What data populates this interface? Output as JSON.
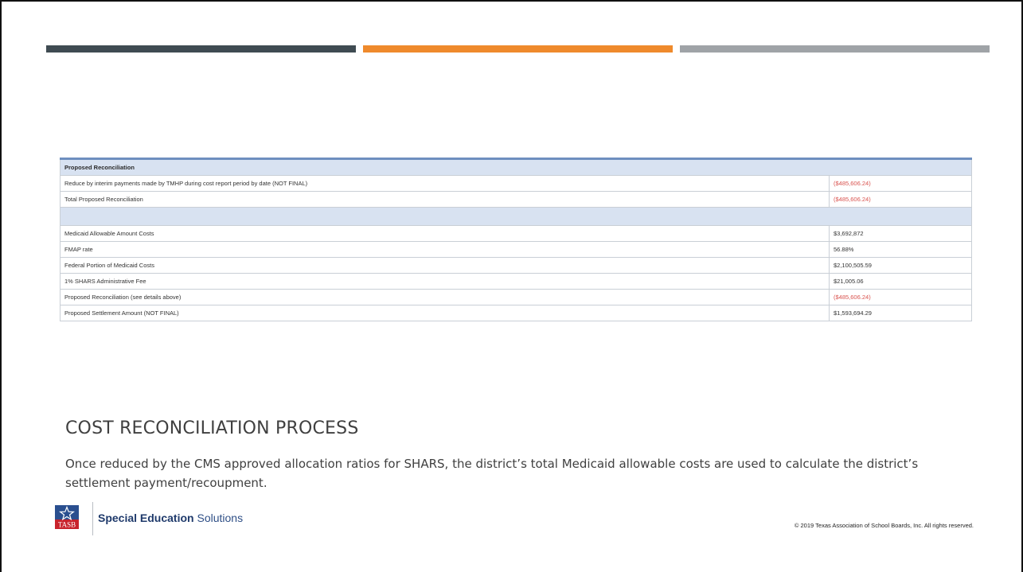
{
  "colors": {
    "bar_dark": "#3f4b52",
    "bar_orange": "#ef8a2c",
    "bar_gray": "#9fa3a7",
    "negative_red": "#d9534f",
    "table_header_bg": "#d8e2f1",
    "brand_navy": "#1f3a6b"
  },
  "table": {
    "header": "Proposed Reconciliation",
    "rows_top": [
      {
        "label": "Reduce by interim payments made by TMHP during cost report period by date (NOT FINAL)",
        "value": "($485,606.24)"
      },
      {
        "label": "Total Proposed Reconciliation",
        "value": "($485,606.24)"
      }
    ],
    "rows_bottom": [
      {
        "label": "Medicaid Allowable Amount Costs",
        "value": "$3,692,872"
      },
      {
        "label": "FMAP rate",
        "value": "56.88%"
      },
      {
        "label": "Federal Portion of Medicaid Costs",
        "value": "$2,100,505.59"
      },
      {
        "label": "1% SHARS Administrative Fee",
        "value": "$21,005.06"
      },
      {
        "label": "Proposed Reconciliation (see details above)",
        "value": "($485,606.24)"
      },
      {
        "label": "Proposed Settlement Amount (NOT FINAL)",
        "value": "$1,593,694.29"
      }
    ]
  },
  "slide": {
    "title": "COST RECONCILIATION PROCESS",
    "body": "Once reduced by the CMS approved allocation ratios for SHARS, the district’s total Medicaid allowable costs are used to calculate the district’s settlement payment/recoupment."
  },
  "footer": {
    "logo_text": "TASB",
    "logo_icon": "star-icon",
    "brand_bold": "Special Education",
    "brand_light": " Solutions",
    "copyright": "© 2019 Texas Association of School Boards, Inc. All rights reserved."
  }
}
